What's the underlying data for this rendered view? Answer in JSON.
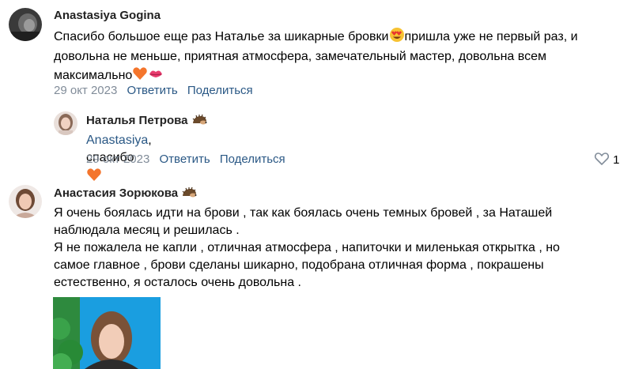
{
  "comments": [
    {
      "author": "Anastasiya Gogina",
      "lines": [
        "Спасибо большое еще раз Наталье за шикарные бровки",
        "пришла уже не первый раз, и",
        "довольна не меньше, приятная атмосфера, замечательный мастер, довольна всем",
        "максимально"
      ],
      "date": "29 окт 2023",
      "reply_label": "Ответить",
      "share_label": "Поделиться"
    },
    {
      "author": "Наталья Петрова",
      "mention": "Anastasiya",
      "text": ", спасибо",
      "date": "29 окт 2023",
      "reply_label": "Ответить",
      "share_label": "Поделиться",
      "likes": "1"
    },
    {
      "author": "Анастасия Зорюкова",
      "lines": [
        "Я очень боялась идти на брови , так как боялась очень темных бровей , за Наташей",
        "наблюдала месяц и решилась .",
        "Я не пожалела не капли , отличная атмосфера , напиточки и миленькая открытка , но",
        "самое главное , брови сделаны шикарно, подобрана отличная форма , покрашены",
        "естественно, я осталось очень довольна ."
      ]
    }
  ],
  "icons": {
    "heart_eyes": "heart-eyes-emoji",
    "orange_heart": "orange-heart-emoji",
    "kiss": "kiss-mark-emoji",
    "hedgehog": "hedgehog-emoji",
    "like": "heart-outline-icon"
  },
  "colors": {
    "link": "#2a5885",
    "meta": "#818c99",
    "orange_heart": "#f4752c"
  }
}
